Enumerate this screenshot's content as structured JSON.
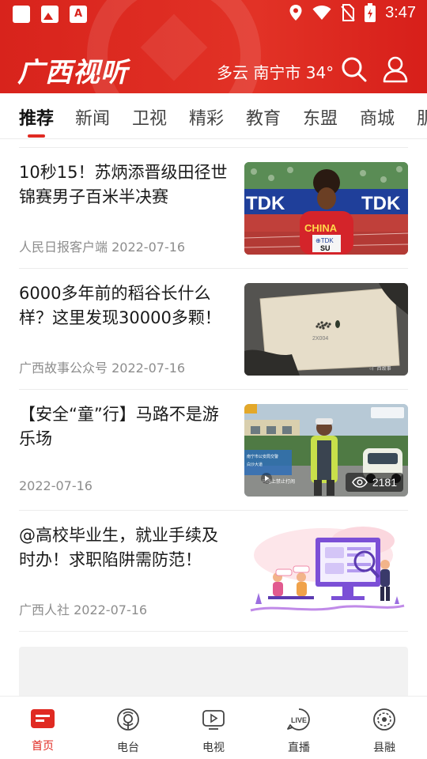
{
  "status_bar": {
    "time": "3:47"
  },
  "header": {
    "logo": "广西视听",
    "weather": "多云 南宁市 34°"
  },
  "tabs": [
    {
      "label": "推荐"
    },
    {
      "label": "新闻"
    },
    {
      "label": "卫视"
    },
    {
      "label": "精彩"
    },
    {
      "label": "教育"
    },
    {
      "label": "东盟"
    },
    {
      "label": "商城"
    },
    {
      "label": "肌"
    }
  ],
  "articles": [
    {
      "title": "10秒15！苏炳添晋级田径世锦赛男子百米半决赛",
      "meta": "人民日报客户端 2022-07-16"
    },
    {
      "title": "6000多年前的稻谷长什么样？这里发现30000多颗！",
      "meta": "广西故事公众号 2022-07-16"
    },
    {
      "title": "【安全“童”行】马路不是游乐场",
      "meta": "2022-07-16",
      "views": "2181"
    },
    {
      "title": "@高校毕业生，就业手续及时办！求职陷阱需防范！",
      "meta": "广西人社 2022-07-16"
    }
  ],
  "bottom_nav": [
    {
      "label": "首页",
      "icon": "home-icon"
    },
    {
      "label": "电台",
      "icon": "radio-icon"
    },
    {
      "label": "电视",
      "icon": "tv-icon"
    },
    {
      "label": "直播",
      "icon": "live-icon"
    },
    {
      "label": "县融",
      "icon": "county-icon"
    }
  ],
  "colors": {
    "brand_red": "#e02a22",
    "text": "#1a1a1a",
    "meta": "#8d8d8d"
  }
}
